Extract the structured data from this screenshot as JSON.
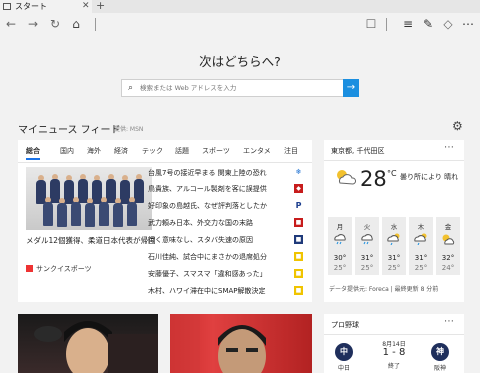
{
  "tab": {
    "title": "スタート"
  },
  "hero": {
    "title": "次はどちらへ?"
  },
  "search": {
    "placeholder": "検索または Web アドレスを入力"
  },
  "feed": {
    "title": "マイニュース フィード",
    "provider": "提供: MSN",
    "categories": [
      "総合",
      "国内",
      "海外",
      "経済",
      "テック",
      "話題",
      "スポーツ",
      "エンタメ",
      "注目"
    ],
    "active_category": "総合",
    "main_story": {
      "caption": "メダル12個獲得、柔道日本代表が帰国",
      "source": "サンクイスポーツ"
    },
    "headlines": [
      "台風7号の接近早まる 関東上陸の恐れ",
      "鳥貴族、アルコール製剤を客に誤提供",
      "好印象の島越氏、なぜ評判落としたか",
      "武力頼み日本、外交力な国の末路",
      "行く意味なし、スタバ失速の原因",
      "石川佳純、試合中にまさかの退席処分",
      "安藤優子、スマスマ「違和感あった」",
      "木村、ハワイ滞在中にSMAP解散決定"
    ]
  },
  "weather": {
    "location": "東京都, 千代田区",
    "temp": "28",
    "unit": "°C",
    "desc": "曇り所により 晴れ",
    "days": [
      {
        "name": "月",
        "hi": "30°",
        "lo": "25°"
      },
      {
        "name": "火",
        "hi": "31°",
        "lo": "25°"
      },
      {
        "name": "水",
        "hi": "31°",
        "lo": "25°"
      },
      {
        "name": "木",
        "hi": "31°",
        "lo": "25°"
      },
      {
        "name": "金",
        "hi": "32°",
        "lo": "24°"
      }
    ],
    "footer": "データ提供元: Foreca | 最終更新 8 分前"
  },
  "baseball": {
    "title": "プロ野球",
    "date": "8月14日",
    "score": "1 - 8",
    "status": "終了",
    "home": {
      "mark": "中",
      "name": "中日"
    },
    "away": {
      "mark": "神",
      "name": "阪神"
    }
  },
  "icons": {
    "back": "arrow-left",
    "forward": "arrow-right",
    "refresh": "refresh",
    "home": "home",
    "reading": "reading-view",
    "star": "star",
    "hub": "hub",
    "note": "web-note",
    "share": "share",
    "more": "more"
  },
  "colors": {
    "accent": "#1b8fe0",
    "active_tab": "#1a73e8"
  }
}
